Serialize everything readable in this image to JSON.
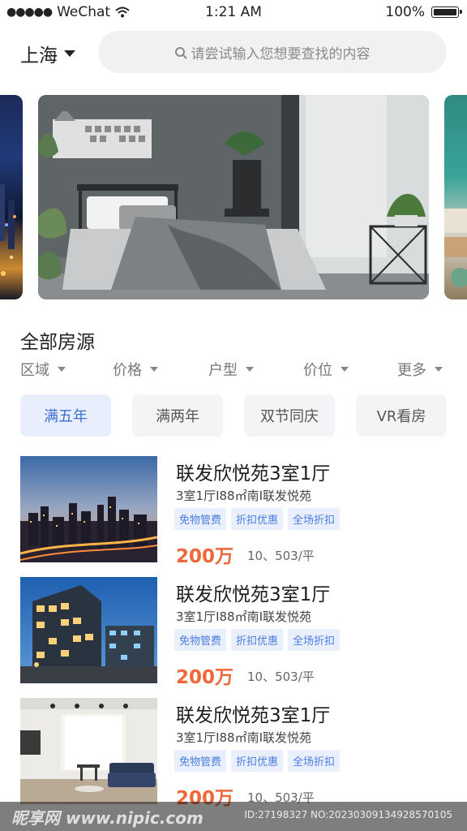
{
  "status_bar": {
    "carrier": "WeChat",
    "time": "1:21 AM",
    "battery": "100%"
  },
  "header": {
    "city": "上海",
    "search_placeholder": "请尝试输入您想要查找的内容"
  },
  "section": {
    "title": "全部房源"
  },
  "filters": [
    "区域",
    "价格",
    "户型",
    "价位",
    "更多"
  ],
  "chips": [
    {
      "label": "满五年",
      "active": true
    },
    {
      "label": "满两年",
      "active": false
    },
    {
      "label": "双节同庆",
      "active": false
    },
    {
      "label": "VR看房",
      "active": false
    }
  ],
  "listings": [
    {
      "title": "联发欣悦苑3室1厅",
      "subtitle": "3室1厅I88㎡南I联发悦苑",
      "tags": [
        "免物管费",
        "折扣优惠",
        "全场折扣"
      ],
      "price": "200万",
      "unit_price": "10、503/平"
    },
    {
      "title": "联发欣悦苑3室1厅",
      "subtitle": "3室1厅I88㎡南I联发悦苑",
      "tags": [
        "免物管费",
        "折扣优惠",
        "全场折扣"
      ],
      "price": "200万",
      "unit_price": "10、503/平"
    },
    {
      "title": "联发欣悦苑3室1厅",
      "subtitle": "3室1厅I88㎡南I联发悦苑",
      "tags": [
        "免物管费",
        "折扣优惠",
        "全场折扣"
      ],
      "price": "200万",
      "unit_price": "10、503/平"
    }
  ],
  "watermark": {
    "left": "昵享网 www.nipic.com",
    "right": "ID:27198327 NO:20230309134928570105"
  },
  "colors": {
    "accent": "#3d6fd8",
    "price": "#f0673a",
    "chip_active_bg": "#e8eefb",
    "tag_bg": "#e9effc"
  }
}
